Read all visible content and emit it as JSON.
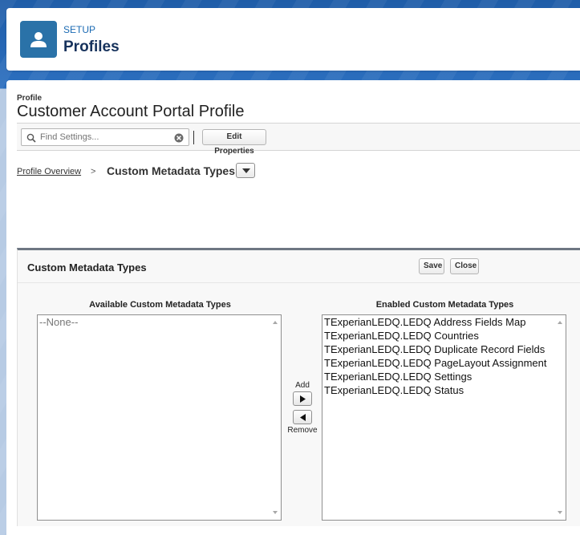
{
  "setup_header": {
    "eyebrow": "SETUP",
    "title": "Profiles"
  },
  "profile": {
    "label": "Profile",
    "name": "Customer Account Portal Profile"
  },
  "toolbar": {
    "search_placeholder": "Find Settings...",
    "edit_properties_label": "Edit Properties"
  },
  "breadcrumb": {
    "link_label": "Profile Overview",
    "separator": ">",
    "current": "Custom Metadata Types"
  },
  "section": {
    "title": "Custom Metadata Types",
    "save_label": "Save",
    "close_label": "Close",
    "available_header": "Available Custom Metadata Types",
    "enabled_header": "Enabled Custom Metadata Types",
    "add_label": "Add",
    "remove_label": "Remove",
    "available_items": [
      "--None--"
    ],
    "enabled_items": [
      "TExperianLEDQ.LEDQ Address Fields Map",
      "TExperianLEDQ.LEDQ Countries",
      "TExperianLEDQ.LEDQ Duplicate Record Fields",
      "TExperianLEDQ.LEDQ PageLayout Assignment",
      "TExperianLEDQ.LEDQ Settings",
      "TExperianLEDQ.LEDQ Status"
    ]
  },
  "icons": {
    "setup_icon": "user-icon",
    "search": "search-icon",
    "clear": "clear-icon",
    "dropdown": "chevron-down-icon",
    "add": "arrow-right-icon",
    "remove": "arrow-left-icon"
  },
  "colors": {
    "brand_blue": "#2a72a8",
    "header_title": "#16325c",
    "eyebrow": "#1a6ab3"
  }
}
